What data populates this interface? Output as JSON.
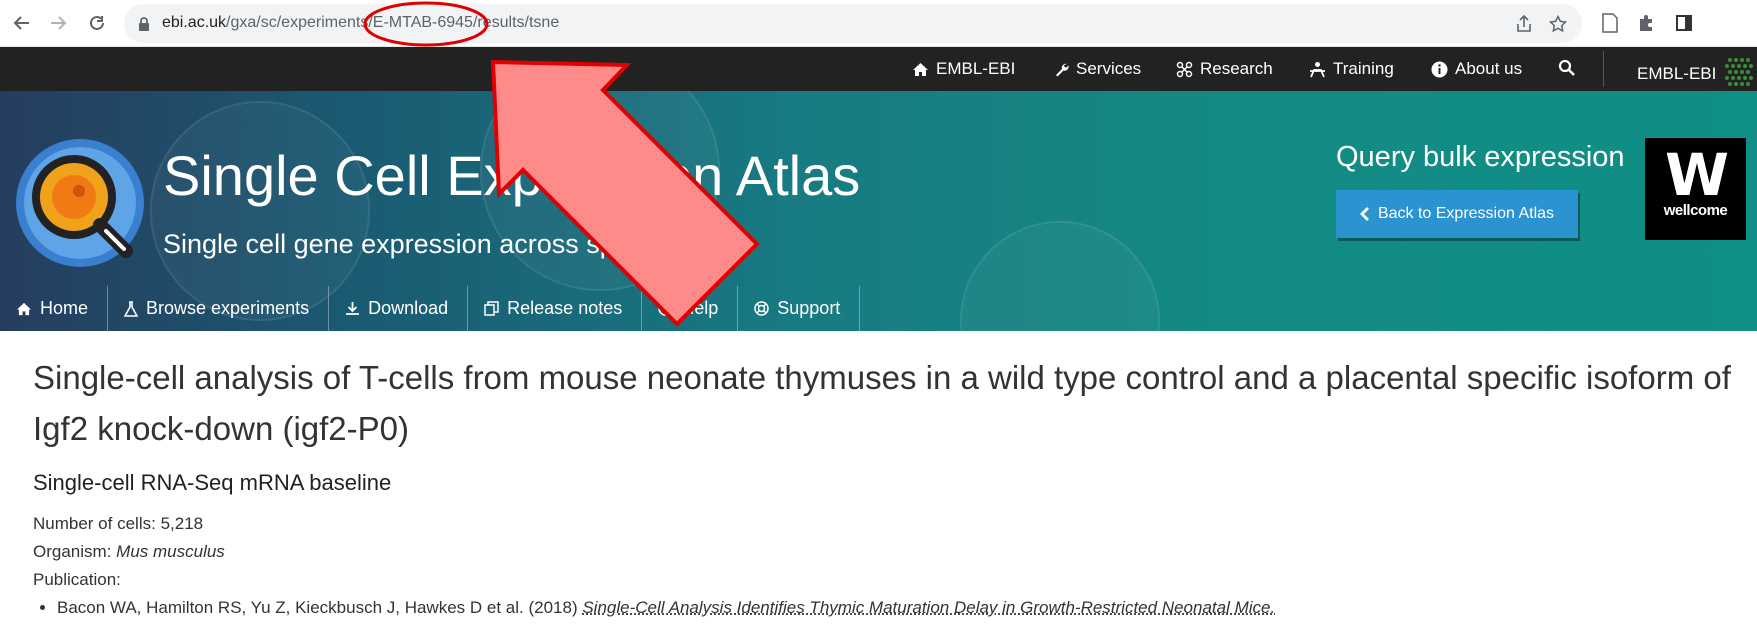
{
  "browser": {
    "url_host": "ebi.ac.uk",
    "url_path": "/gxa/sc/experiments/E-MTAB-6945/results/tsne"
  },
  "ebi_nav": {
    "items": [
      {
        "label": "EMBL-EBI",
        "icon": "home-icon"
      },
      {
        "label": "Services",
        "icon": "wrench-icon"
      },
      {
        "label": "Research",
        "icon": "molecule-icon"
      },
      {
        "label": "Training",
        "icon": "presenter-icon"
      },
      {
        "label": "About us",
        "icon": "info-icon"
      }
    ],
    "brand": "EMBL-EBI"
  },
  "masthead": {
    "title": "Single Cell Expression Atlas",
    "subtitle": "Single cell gene expression across species",
    "query_title": "Query bulk expression",
    "back_button": "Back to Expression Atlas",
    "wellcome_label": "wellcome"
  },
  "local_nav": [
    {
      "label": "Home",
      "icon": "home-icon"
    },
    {
      "label": "Browse experiments",
      "icon": "flask-icon"
    },
    {
      "label": "Download",
      "icon": "download-icon"
    },
    {
      "label": "Release notes",
      "icon": "copy-icon"
    },
    {
      "label": "Help",
      "icon": "question-icon"
    },
    {
      "label": "Support",
      "icon": "lifebuoy-icon"
    }
  ],
  "experiment": {
    "title": "Single-cell analysis of T-cells from mouse neonate thymuses in a wild type control and a placental specific isoform of Igf2 knock-down (igf2-P0)",
    "type": "Single-cell RNA-Seq mRNA baseline",
    "cells_label": "Number of cells:",
    "cells_value": "5,218",
    "organism_label": "Organism:",
    "organism_value": "Mus musculus",
    "publication_label": "Publication:",
    "publication_authors": "Bacon WA, Hamilton RS, Yu Z, Kieckbusch J, Hawkes D et al. (2018)",
    "publication_title": "Single-Cell Analysis Identifies Thymic Maturation Delay in Growth-Restricted Neonatal Mice."
  },
  "colors": {
    "ebi_bar": "#222222",
    "masthead_teal": "#138a83",
    "button_blue": "#2b93cf",
    "arrow_fill": "#ff8a8a",
    "arrow_stroke": "#e00000"
  }
}
